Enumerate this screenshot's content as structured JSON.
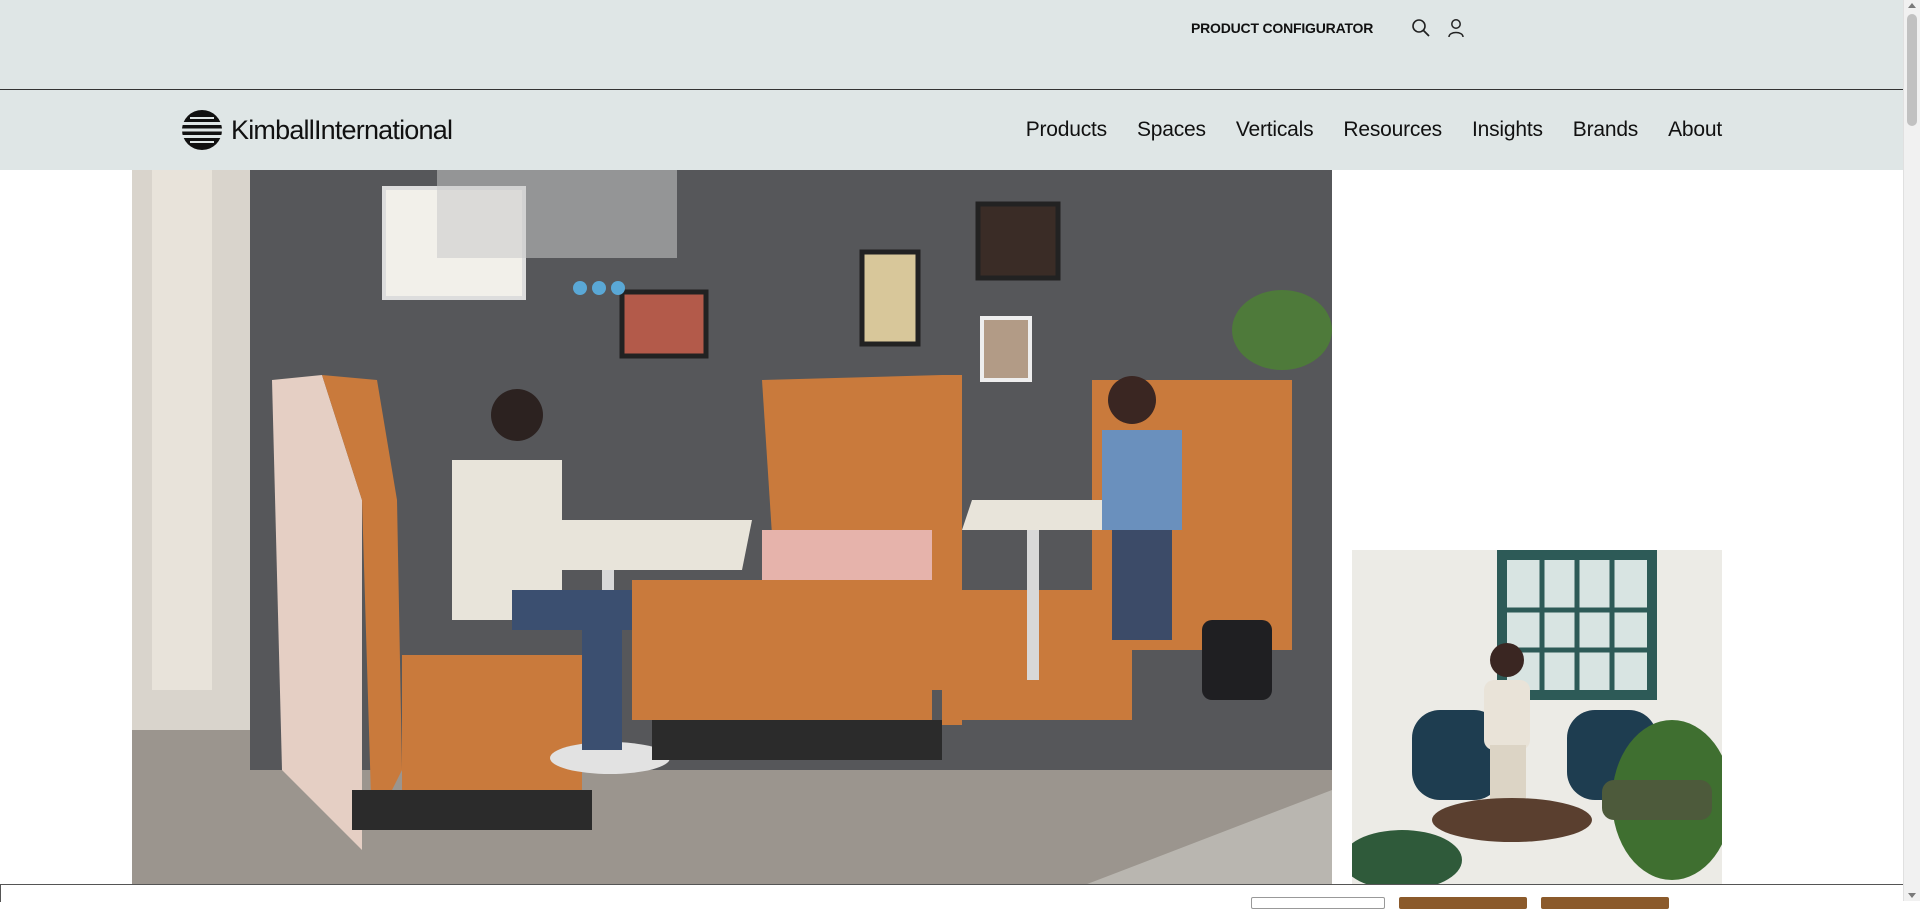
{
  "utility": {
    "configurator_label": "PRODUCT CONFIGURATOR",
    "search_icon": "search-icon",
    "account_icon": "user-icon"
  },
  "logo": {
    "brand_bold": "Kimball",
    "brand_rest": "International"
  },
  "nav": {
    "items": [
      {
        "label": "Products"
      },
      {
        "label": "Spaces"
      },
      {
        "label": "Verticals"
      },
      {
        "label": "Resources"
      },
      {
        "label": "Insights"
      },
      {
        "label": "Brands"
      },
      {
        "label": "About"
      }
    ]
  },
  "colors": {
    "header_bg": "#dfe6e6",
    "accent_button": "#8b5a2b",
    "booth_orange": "#c97a3c"
  }
}
